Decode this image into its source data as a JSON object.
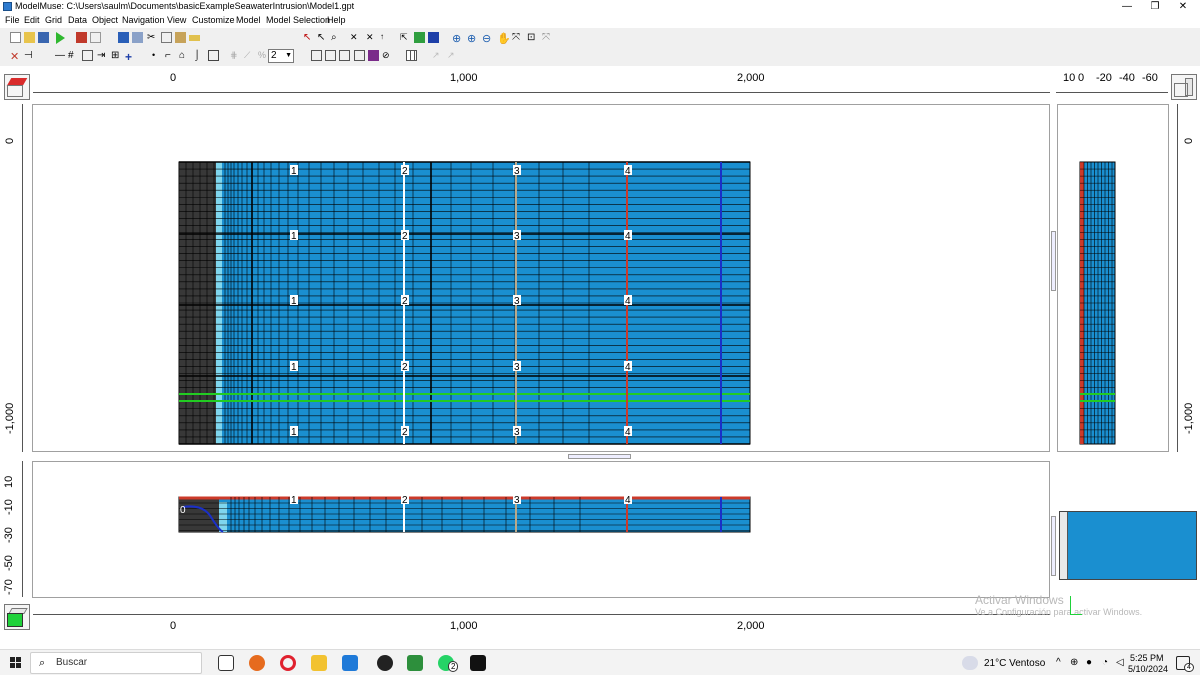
{
  "window": {
    "title": "ModelMuse: C:\\Users\\saulm\\Documents\\basicExampleSeawaterIntrusion\\Model1.gpt",
    "minimize": "—",
    "maximize": "❐",
    "close": "✕"
  },
  "menu": [
    "File",
    "Edit",
    "Grid",
    "Data",
    "Object",
    "Navigation",
    "View",
    "Customize",
    "Model",
    "Model Selection",
    "Help"
  ],
  "toolbar": {
    "layer_value": "2"
  },
  "top_view": {
    "ruler_labels": [
      "0",
      "1,000",
      "2,000"
    ],
    "y_labels": [
      "0",
      "-1,000"
    ],
    "column_markers": [
      "1",
      "2",
      "3",
      "4"
    ],
    "marker_rows": 5
  },
  "side_view": {
    "ruler_labels": [
      "10",
      "0",
      "-20",
      "-40",
      "-60"
    ],
    "y_labels": [
      "0",
      "-1,000"
    ]
  },
  "front_view": {
    "ruler_labels": [
      "0",
      "1,000",
      "2,000"
    ],
    "y_labels": [
      "10",
      "-10",
      "-30",
      "-50",
      "-70"
    ],
    "column_markers": [
      "1",
      "2",
      "3",
      "4"
    ],
    "head_label": "0"
  },
  "colors": {
    "cell_blue": "#1a8fd0",
    "cell_light": "#7fd6ee",
    "inactive": "#383838",
    "green_line": "#22cc22",
    "red_line": "#cc3a2a",
    "dark_blue_line": "#1a2fc8",
    "tan_line": "#b9a98a"
  },
  "watermark": {
    "line1": "Activar Windows",
    "line2": "Ve a Configuración para activar Windows."
  },
  "taskbar": {
    "search_placeholder": "Buscar",
    "weather": "21°C  Ventoso",
    "time": "5:25 PM",
    "date": "5/10/2024",
    "notification_badge": "4",
    "whatsapp_badge": "2"
  }
}
